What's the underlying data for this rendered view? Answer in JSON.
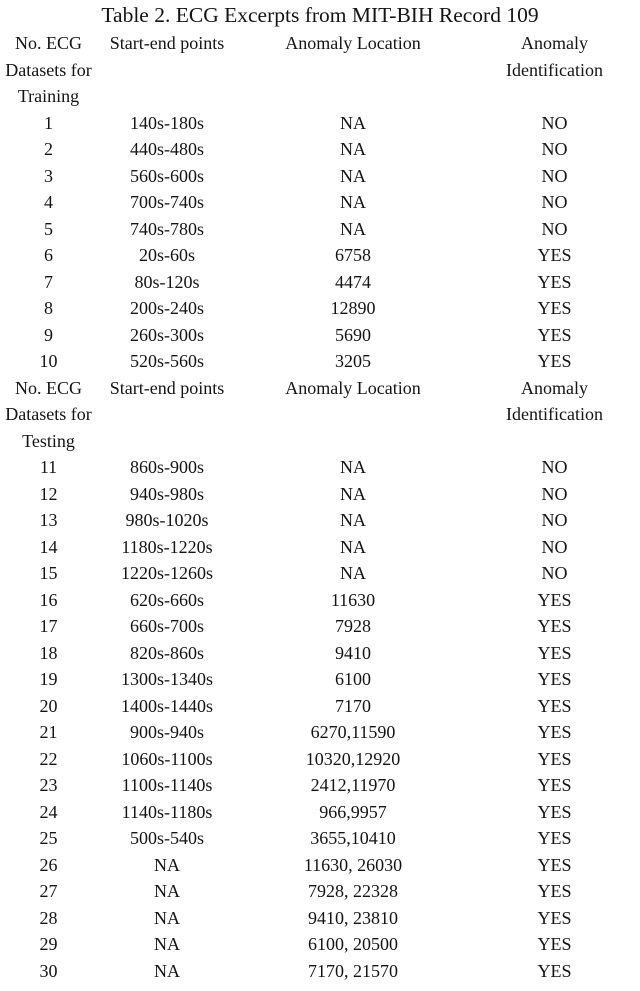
{
  "title": "Table 2. ECG Excerpts from MIT-BIH Record 109",
  "columns": {
    "no_line1": "No. ECG",
    "no_line2": "Datasets for",
    "start_end": "Start-end points",
    "anomaly_location": "Anomaly Location",
    "anomaly_identification_line1": "Anomaly",
    "anomaly_identification_line2": "Identification"
  },
  "sections": [
    {
      "header_line3": "Training",
      "rows": [
        {
          "no": "1",
          "start_end": "140s-180s",
          "location": "NA",
          "identification": "NO"
        },
        {
          "no": "2",
          "start_end": "440s-480s",
          "location": "NA",
          "identification": "NO"
        },
        {
          "no": "3",
          "start_end": "560s-600s",
          "location": "NA",
          "identification": "NO"
        },
        {
          "no": "4",
          "start_end": "700s-740s",
          "location": "NA",
          "identification": "NO"
        },
        {
          "no": "5",
          "start_end": "740s-780s",
          "location": "NA",
          "identification": "NO"
        },
        {
          "no": "6",
          "start_end": "20s-60s",
          "location": "6758",
          "identification": "YES"
        },
        {
          "no": "7",
          "start_end": "80s-120s",
          "location": "4474",
          "identification": "YES"
        },
        {
          "no": "8",
          "start_end": "200s-240s",
          "location": "12890",
          "identification": "YES"
        },
        {
          "no": "9",
          "start_end": "260s-300s",
          "location": "5690",
          "identification": "YES"
        },
        {
          "no": "10",
          "start_end": "520s-560s",
          "location": "3205",
          "identification": "YES"
        }
      ]
    },
    {
      "header_line3": "Testing",
      "rows": [
        {
          "no": "11",
          "start_end": "860s-900s",
          "location": "NA",
          "identification": "NO"
        },
        {
          "no": "12",
          "start_end": "940s-980s",
          "location": "NA",
          "identification": "NO"
        },
        {
          "no": "13",
          "start_end": "980s-1020s",
          "location": "NA",
          "identification": "NO"
        },
        {
          "no": "14",
          "start_end": "1180s-1220s",
          "location": "NA",
          "identification": "NO"
        },
        {
          "no": "15",
          "start_end": "1220s-1260s",
          "location": "NA",
          "identification": "NO"
        },
        {
          "no": "16",
          "start_end": "620s-660s",
          "location": "11630",
          "identification": "YES"
        },
        {
          "no": "17",
          "start_end": "660s-700s",
          "location": "7928",
          "identification": "YES"
        },
        {
          "no": "18",
          "start_end": "820s-860s",
          "location": "9410",
          "identification": "YES"
        },
        {
          "no": "19",
          "start_end": "1300s-1340s",
          "location": "6100",
          "identification": "YES"
        },
        {
          "no": "20",
          "start_end": "1400s-1440s",
          "location": "7170",
          "identification": "YES"
        },
        {
          "no": "21",
          "start_end": "900s-940s",
          "location": "6270,11590",
          "identification": "YES"
        },
        {
          "no": "22",
          "start_end": "1060s-1100s",
          "location": "10320,12920",
          "identification": "YES"
        },
        {
          "no": "23",
          "start_end": "1100s-1140s",
          "location": "2412,11970",
          "identification": "YES"
        },
        {
          "no": "24",
          "start_end": "1140s-1180s",
          "location": "966,9957",
          "identification": "YES"
        },
        {
          "no": "25",
          "start_end": "500s-540s",
          "location": "3655,10410",
          "identification": "YES"
        },
        {
          "no": "26",
          "start_end": "NA",
          "location": "11630, 26030",
          "identification": "YES"
        },
        {
          "no": "27",
          "start_end": "NA",
          "location": "7928, 22328",
          "identification": "YES"
        },
        {
          "no": "28",
          "start_end": "NA",
          "location": "9410, 23810",
          "identification": "YES"
        },
        {
          "no": "29",
          "start_end": "NA",
          "location": "6100, 20500",
          "identification": "YES"
        },
        {
          "no": "30",
          "start_end": "NA",
          "location": "7170, 21570",
          "identification": "YES"
        }
      ]
    }
  ]
}
